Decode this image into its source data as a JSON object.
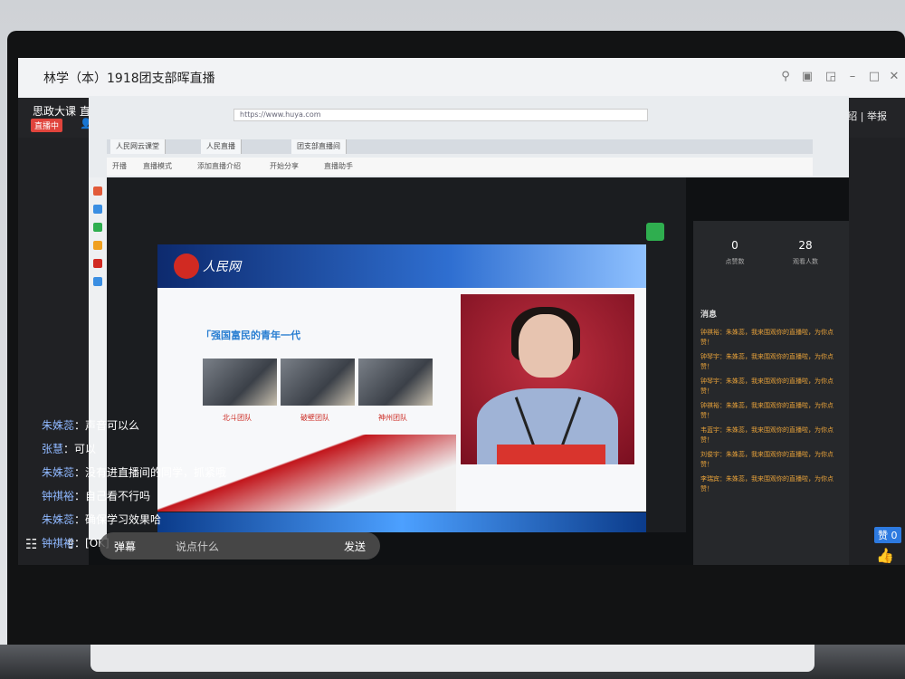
{
  "window": {
    "title": "林学（本）1918团支部晖直播"
  },
  "header": {
    "course": "思政大课 直播",
    "live_badge": "直播中",
    "links": "新闻简介绍  |  举报"
  },
  "browser": {
    "url": "https://www.huya.com",
    "tabs": [
      "人民网云课堂",
      "人民直播",
      "团支部直播间"
    ],
    "toolbar": [
      "开播",
      "直播模式",
      "添加直播介绍",
      "开始分享",
      "直播助手"
    ]
  },
  "slide": {
    "logo_text": "人民网",
    "title": "「强国富民的青年一代",
    "labels": [
      "北斗团队",
      "破壁团队",
      "神州团队"
    ]
  },
  "chat_panel": {
    "online": "0",
    "online_label": "点赞数",
    "viewers": "28",
    "viewers_label": "观看人数",
    "heading": "消息",
    "messages": [
      "钟祺裕：朱姝蕊，我来围观你的直播啦，为你点赞！",
      "钟琴宇：朱姝蕊，我来围观你的直播啦，为你点赞！",
      "钟琴宇：朱姝蕊，我来围观你的直播啦，为你点赞！",
      "钟祺裕：朱姝蕊，我来围观你的直播啦，为你点赞！",
      "韦蓝宇：朱姝蕊，我来围观你的直播啦，为你点赞！",
      "刘俊宇：朱姝蕊，我来围观你的直播啦，为你点赞！",
      "李瑞宾：朱姝蕊，我来围观你的直播啦，为你点赞！"
    ]
  },
  "comments": [
    {
      "name": "朱姝蕊",
      "text": "声音可以么"
    },
    {
      "name": "张慧",
      "text": "可以"
    },
    {
      "name": "朱姝蕊",
      "text": "没有进直播间的同学，抓紧哦"
    },
    {
      "name": "钟祺裕",
      "text": "自己看不行吗"
    },
    {
      "name": "朱姝蕊",
      "text": "确保学习效果哈"
    },
    {
      "name": "钟祺裕",
      "text": "[OK]"
    }
  ],
  "bottom": {
    "danmu_label": "弹幕",
    "placeholder": "说点什么",
    "send_label": "发送",
    "like_count": "赞 0"
  }
}
